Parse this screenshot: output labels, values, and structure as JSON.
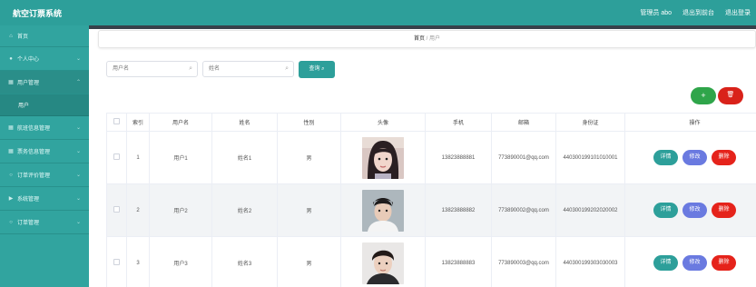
{
  "header": {
    "title": "航空订票系统",
    "admin": "管理员 abo",
    "back_to_front": "退出到前台",
    "logout": "退出登录"
  },
  "sidebar": {
    "items": [
      {
        "label": "首页",
        "icon": "home-icon"
      },
      {
        "label": "个人中心",
        "icon": "person-icon"
      },
      {
        "label": "用户管理",
        "icon": "users-icon",
        "sub": "用户"
      },
      {
        "label": "航班信息管理",
        "icon": "flight-icon"
      },
      {
        "label": "票务信息管理",
        "icon": "ticket-icon"
      },
      {
        "label": "订单评价管理",
        "icon": "comment-icon"
      },
      {
        "label": "系统管理",
        "icon": "settings-icon"
      },
      {
        "label": "订单管理",
        "icon": "order-icon"
      }
    ]
  },
  "breadcrumb": {
    "home": "首页",
    "sep": "/",
    "current": "用户"
  },
  "search": {
    "username_placeholder": "用户名",
    "name_placeholder": "姓名",
    "button": "查询"
  },
  "actions": {
    "add": "+",
    "delete": "🗑"
  },
  "table": {
    "headers": [
      "索引",
      "用户名",
      "姓名",
      "性别",
      "头像",
      "手机",
      "邮箱",
      "身份证",
      "操作"
    ],
    "rows": [
      {
        "index": "1",
        "username": "用户1",
        "name": "姓名1",
        "gender": "男",
        "phone": "13823888881",
        "email": "773890001@qq.com",
        "idcard": "440300199101010001"
      },
      {
        "index": "2",
        "username": "用户2",
        "name": "姓名2",
        "gender": "男",
        "phone": "13823888882",
        "email": "773890002@qq.com",
        "idcard": "440300199202020002"
      },
      {
        "index": "3",
        "username": "用户3",
        "name": "姓名3",
        "gender": "男",
        "phone": "13823888883",
        "email": "773890003@qq.com",
        "idcard": "440300199303030003"
      }
    ],
    "ops": {
      "detail": "详情",
      "edit": "修改",
      "remove": "删除"
    }
  },
  "colors": {
    "primary": "#2d9f9a",
    "sidebar": "#31a49f",
    "add": "#2fa54a",
    "danger": "#e5231b",
    "edit": "#6a7ae0"
  }
}
